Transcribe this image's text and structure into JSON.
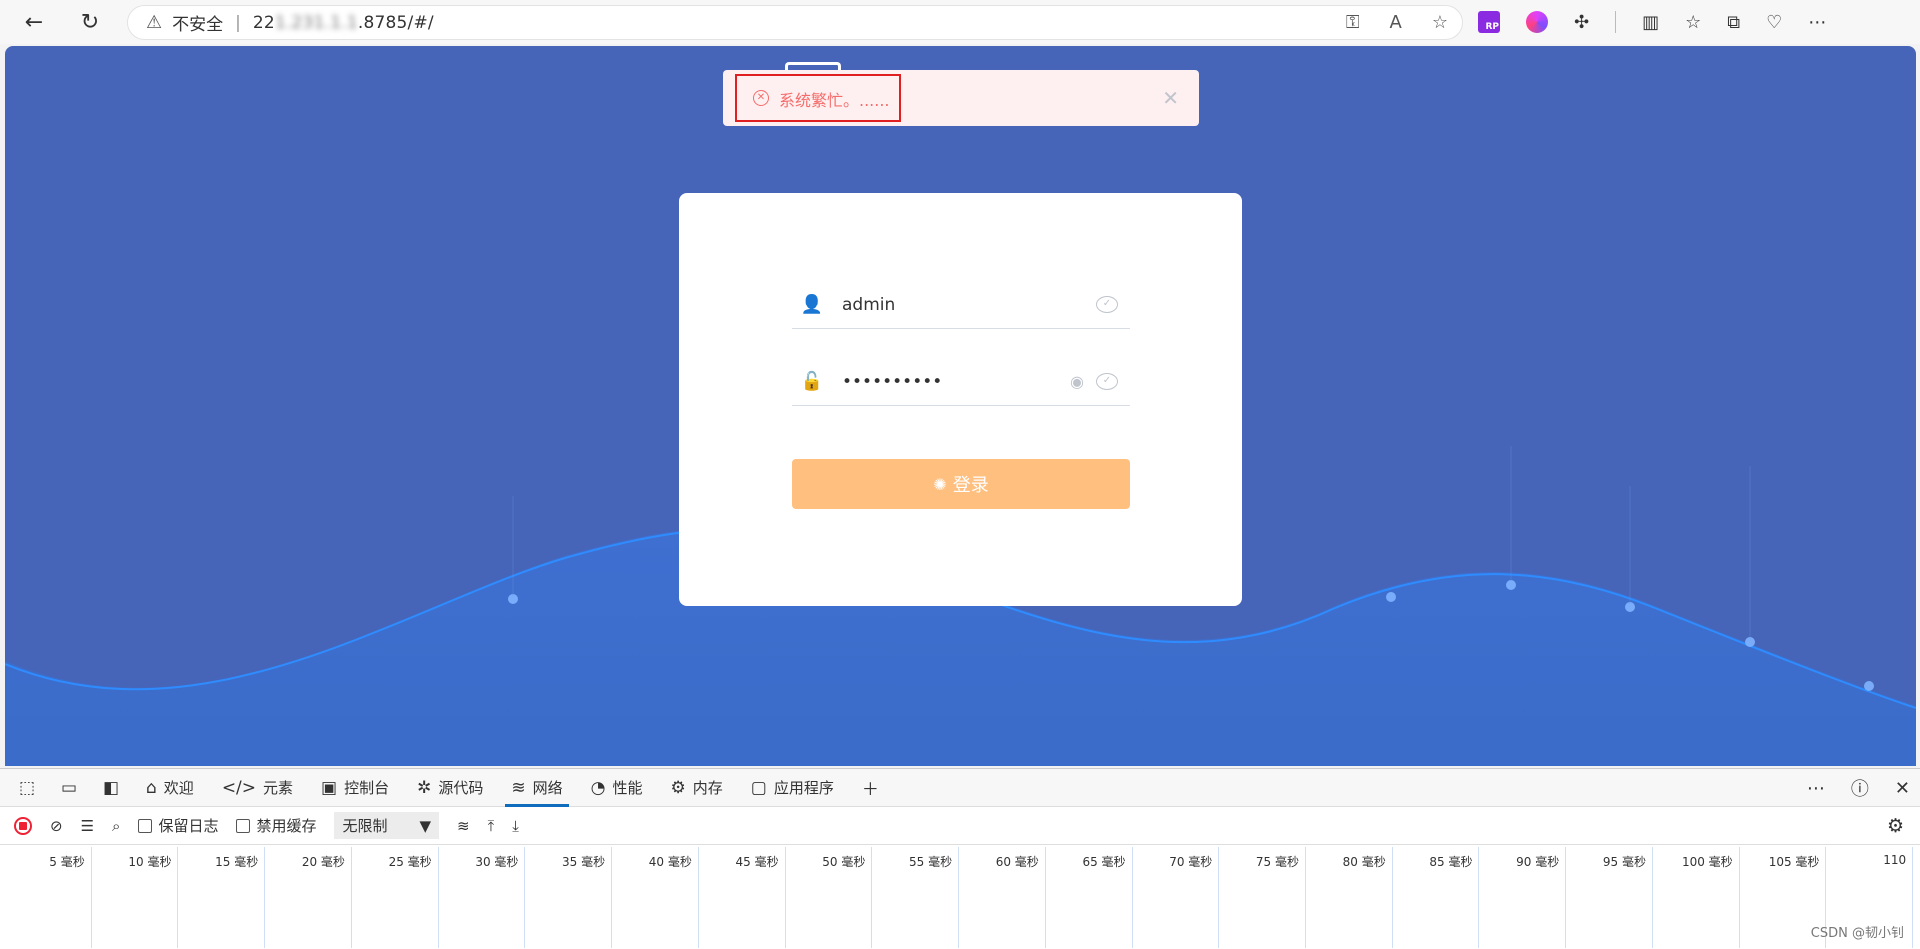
{
  "browser": {
    "security_label": "不安全",
    "url_prefix": "22",
    "url_hidden": "1.231.1.1",
    "url_suffix": ".8785/#/"
  },
  "toast": {
    "message": "系统繁忙。......",
    "color": "#f56c6c"
  },
  "login": {
    "username_value": "admin",
    "password_value": "••••••••••",
    "login_button_label": "登录",
    "button_color": "#ffbf7f"
  },
  "page": {
    "background_color": "#4665b8"
  },
  "devtools": {
    "tabs": [
      {
        "label": "欢迎",
        "icon": "home-icon"
      },
      {
        "label": "元素",
        "icon": "code-icon"
      },
      {
        "label": "控制台",
        "icon": "console-icon"
      },
      {
        "label": "源代码",
        "icon": "bug-icon"
      },
      {
        "label": "网络",
        "icon": "wifi-icon",
        "active": true
      },
      {
        "label": "性能",
        "icon": "gauge-icon"
      },
      {
        "label": "内存",
        "icon": "chip-icon"
      },
      {
        "label": "应用程序",
        "icon": "app-icon"
      }
    ],
    "preserve_log_label": "保留日志",
    "disable_cache_label": "禁用缓存",
    "throttle_value": "无限制",
    "timeline_ticks": [
      "5 毫秒",
      "10 毫秒",
      "15 毫秒",
      "20 毫秒",
      "25 毫秒",
      "30 毫秒",
      "35 毫秒",
      "40 毫秒",
      "45 毫秒",
      "50 毫秒",
      "55 毫秒",
      "60 毫秒",
      "65 毫秒",
      "70 毫秒",
      "75 毫秒",
      "80 毫秒",
      "85 毫秒",
      "90 毫秒",
      "95 毫秒",
      "100 毫秒",
      "105 毫秒",
      "110"
    ]
  },
  "watermark": "CSDN @韧小钊"
}
